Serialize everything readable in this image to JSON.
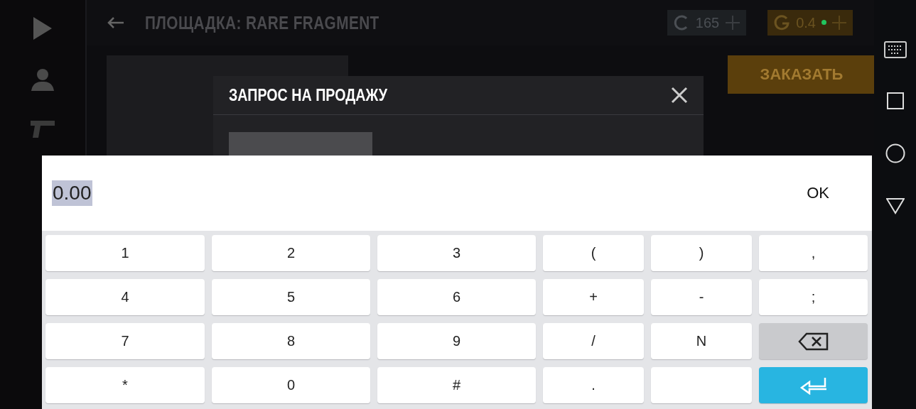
{
  "top_bar": {
    "title": "ПЛОЩАДКА: RARE FRAGMENT",
    "currencies": [
      {
        "kind": "credits",
        "amount": "165"
      },
      {
        "kind": "gold",
        "amount": "0.4"
      }
    ]
  },
  "order_button": {
    "label": "ЗАКАЗАТЬ"
  },
  "dialog": {
    "title": "ЗАПРОС НА ПРОДАЖУ"
  },
  "input_panel": {
    "value": "0.00",
    "text_selected": true,
    "ok_label": "OK"
  },
  "keys": [
    {
      "kind": "char",
      "label": "1"
    },
    {
      "kind": "char",
      "label": "2"
    },
    {
      "kind": "char",
      "label": "3"
    },
    {
      "kind": "char",
      "label": "("
    },
    {
      "kind": "char",
      "label": ")"
    },
    {
      "kind": "char",
      "label": ","
    },
    {
      "kind": "char",
      "label": "4"
    },
    {
      "kind": "char",
      "label": "5"
    },
    {
      "kind": "char",
      "label": "6"
    },
    {
      "kind": "char",
      "label": "+"
    },
    {
      "kind": "char",
      "label": "-"
    },
    {
      "kind": "char",
      "label": ";"
    },
    {
      "kind": "char",
      "label": "7"
    },
    {
      "kind": "char",
      "label": "8"
    },
    {
      "kind": "char",
      "label": "9"
    },
    {
      "kind": "char",
      "label": "/"
    },
    {
      "kind": "char",
      "label": "N"
    },
    {
      "kind": "backspace"
    },
    {
      "kind": "char",
      "label": "*"
    },
    {
      "kind": "char",
      "label": "0"
    },
    {
      "kind": "char",
      "label": "#"
    },
    {
      "kind": "char",
      "label": "."
    },
    {
      "kind": "blank"
    },
    {
      "kind": "enter"
    }
  ]
}
